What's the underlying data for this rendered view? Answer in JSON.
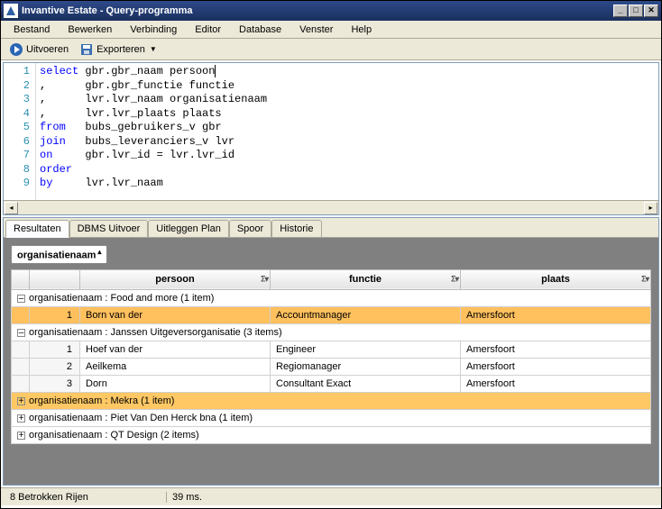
{
  "window": {
    "title": "Invantive Estate - Query-programma"
  },
  "menu": {
    "items": [
      "Bestand",
      "Bewerken",
      "Verbinding",
      "Editor",
      "Database",
      "Venster",
      "Help"
    ]
  },
  "toolbar": {
    "execute_label": "Uitvoeren",
    "export_label": "Exporteren"
  },
  "editor": {
    "lines": [
      {
        "n": 1,
        "pre": "",
        "kw": "select",
        "rest": " gbr.gbr_naam persoon",
        "caret": true
      },
      {
        "n": 2,
        "pre": ",      ",
        "kw": "",
        "rest": "gbr.gbr_functie functie"
      },
      {
        "n": 3,
        "pre": ",      ",
        "kw": "",
        "rest": "lvr.lvr_naam organisatienaam"
      },
      {
        "n": 4,
        "pre": ",      ",
        "kw": "",
        "rest": "lvr.lvr_plaats plaats"
      },
      {
        "n": 5,
        "pre": "",
        "kw": "from",
        "rest": "   bubs_gebruikers_v gbr"
      },
      {
        "n": 6,
        "pre": "",
        "kw": "join",
        "rest": "   bubs_leveranciers_v lvr"
      },
      {
        "n": 7,
        "pre": "",
        "kw": "on",
        "rest": "     gbr.lvr_id = lvr.lvr_id"
      },
      {
        "n": 8,
        "pre": "",
        "kw": "order",
        "rest": ""
      },
      {
        "n": 9,
        "pre": "",
        "kw": "by",
        "rest": "     lvr.lvr_naam"
      }
    ]
  },
  "results": {
    "tabs": [
      {
        "label": "Resultaten",
        "active": true
      },
      {
        "label": "DBMS Uitvoer",
        "active": false
      },
      {
        "label": "Uitleggen Plan",
        "active": false
      },
      {
        "label": "Spoor",
        "active": false
      },
      {
        "label": "Historie",
        "active": false
      }
    ],
    "group_by": "organisatienaam",
    "columns": [
      "persoon",
      "functie",
      "plaats"
    ],
    "groups": [
      {
        "expanded": true,
        "highlight": false,
        "label": "organisatienaam : Food and more (1 item)",
        "rows": [
          {
            "n": 1,
            "hl": true,
            "persoon": "Born van der",
            "functie": "Accountmanager",
            "plaats": "Amersfoort"
          }
        ]
      },
      {
        "expanded": true,
        "highlight": false,
        "label": "organisatienaam : Janssen Uitgeversorganisatie (3 items)",
        "rows": [
          {
            "n": 1,
            "hl": false,
            "persoon": "Hoef van der",
            "functie": "Engineer",
            "plaats": "Amersfoort"
          },
          {
            "n": 2,
            "hl": false,
            "persoon": "Aeilkema",
            "functie": "Regiomanager",
            "plaats": "Amersfoort"
          },
          {
            "n": 3,
            "hl": false,
            "persoon": "Dorn",
            "functie": "Consultant Exact",
            "plaats": "Amersfoort"
          }
        ]
      },
      {
        "expanded": false,
        "highlight": true,
        "label": "organisatienaam : Mekra (1 item)",
        "rows": []
      },
      {
        "expanded": false,
        "highlight": false,
        "label": "organisatienaam : Piet Van Den Herck bna (1 item)",
        "rows": []
      },
      {
        "expanded": false,
        "highlight": false,
        "label": "organisatienaam : QT Design (2 items)",
        "rows": []
      }
    ]
  },
  "status": {
    "rows": "8 Betrokken Rijen",
    "time": "39 ms."
  },
  "glyphs": {
    "minus": "–",
    "plus": "+",
    "sigma": "Σ",
    "filter": "▾",
    "sort_up": "▴"
  }
}
